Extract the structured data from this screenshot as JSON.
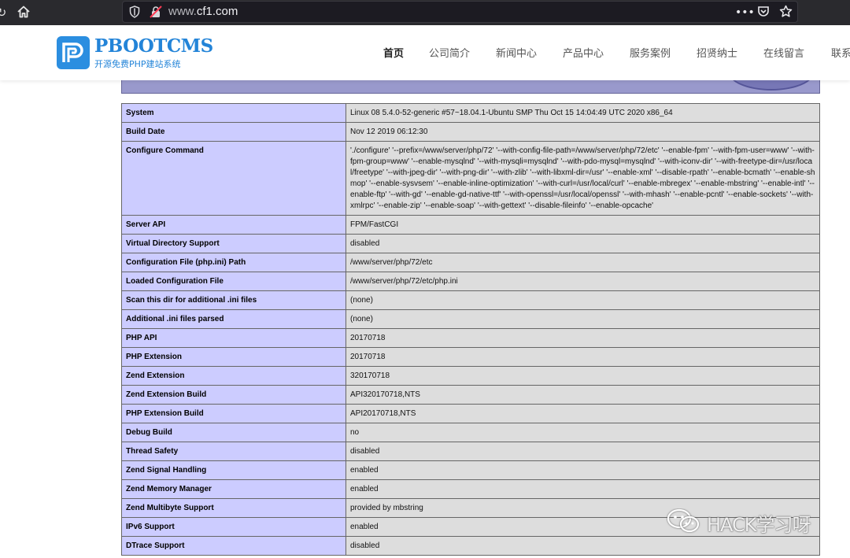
{
  "browser": {
    "url_host": "www.cf1.com",
    "url_prefix": "www.",
    "url_domain": "cf1.com",
    "menu_label": "•••"
  },
  "site": {
    "logo_name": "PBOOTCMS",
    "logo_sub": "开源免费PHP建站系统",
    "nav": [
      {
        "label": "首页",
        "active": true
      },
      {
        "label": "公司简介"
      },
      {
        "label": "新闻中心"
      },
      {
        "label": "产品中心"
      },
      {
        "label": "服务案例"
      },
      {
        "label": "招贤纳士"
      },
      {
        "label": "在线留言"
      },
      {
        "label": "联系"
      }
    ]
  },
  "phpinfo": {
    "rows": [
      {
        "key": "System",
        "value": "Linux 08 5.4.0-52-generic #57~18.04.1-Ubuntu SMP Thu Oct 15 14:04:49 UTC 2020 x86_64"
      },
      {
        "key": "Build Date",
        "value": "Nov 12 2019 06:12:30"
      },
      {
        "key": "Configure Command",
        "value": "'./configure' '--prefix=/www/server/php/72' '--with-config-file-path=/www/server/php/72/etc' '--enable-fpm' '--with-fpm-user=www' '--with-fpm-group=www' '--enable-mysqlnd' '--with-mysqli=mysqlnd' '--with-pdo-mysql=mysqlnd' '--with-iconv-dir' '--with-freetype-dir=/usr/local/freetype' '--with-jpeg-dir' '--with-png-dir' '--with-zlib' '--with-libxml-dir=/usr' '--enable-xml' '--disable-rpath' '--enable-bcmath' '--enable-shmop' '--enable-sysvsem' '--enable-inline-optimization' '--with-curl=/usr/local/curl' '--enable-mbregex' '--enable-mbstring' '--enable-intl' '--enable-ftp' '--with-gd' '--enable-gd-native-ttf' '--with-openssl=/usr/local/openssl' '--with-mhash' '--enable-pcntl' '--enable-sockets' '--with-xmlrpc' '--enable-zip' '--enable-soap' '--with-gettext' '--disable-fileinfo' '--enable-opcache'"
      },
      {
        "key": "Server API",
        "value": "FPM/FastCGI"
      },
      {
        "key": "Virtual Directory Support",
        "value": "disabled"
      },
      {
        "key": "Configuration File (php.ini) Path",
        "value": "/www/server/php/72/etc"
      },
      {
        "key": "Loaded Configuration File",
        "value": "/www/server/php/72/etc/php.ini"
      },
      {
        "key": "Scan this dir for additional .ini files",
        "value": "(none)"
      },
      {
        "key": "Additional .ini files parsed",
        "value": "(none)"
      },
      {
        "key": "PHP API",
        "value": "20170718"
      },
      {
        "key": "PHP Extension",
        "value": "20170718"
      },
      {
        "key": "Zend Extension",
        "value": "320170718"
      },
      {
        "key": "Zend Extension Build",
        "value": "API320170718,NTS"
      },
      {
        "key": "PHP Extension Build",
        "value": "API20170718,NTS"
      },
      {
        "key": "Debug Build",
        "value": "no"
      },
      {
        "key": "Thread Safety",
        "value": "disabled"
      },
      {
        "key": "Zend Signal Handling",
        "value": "enabled"
      },
      {
        "key": "Zend Memory Manager",
        "value": "enabled"
      },
      {
        "key": "Zend Multibyte Support",
        "value": "provided by mbstring"
      },
      {
        "key": "IPv6 Support",
        "value": "enabled"
      },
      {
        "key": "DTrace Support",
        "value": "disabled"
      }
    ]
  },
  "watermark": {
    "text": "HACK学习呀"
  }
}
